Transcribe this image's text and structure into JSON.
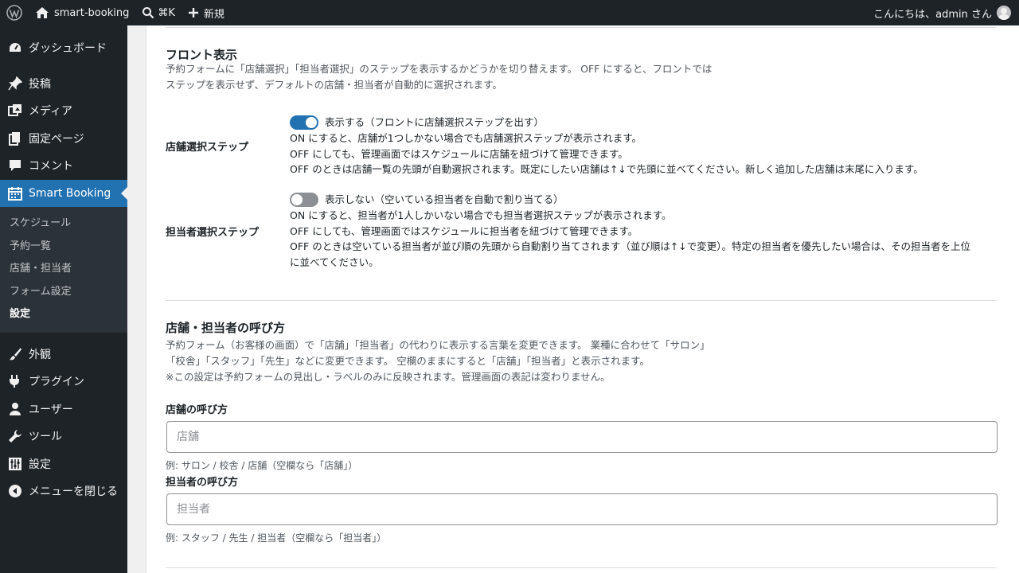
{
  "adminbar": {
    "site_name": "smart-booking",
    "search_shortcut": "⌘K",
    "new_label": "新規",
    "greeting": "こんにちは、admin さん"
  },
  "menu": {
    "dashboard": "ダッシュボード",
    "posts": "投稿",
    "media": "メディア",
    "pages": "固定ページ",
    "comments": "コメント",
    "smart_booking": "Smart Booking",
    "submenu": [
      "スケジュール",
      "予約一覧",
      "店舗・担当者",
      "フォーム設定",
      "設定"
    ],
    "appearance": "外観",
    "plugins": "プラグイン",
    "users": "ユーザー",
    "tools": "ツール",
    "settings": "設定",
    "collapse": "メニューを閉じる"
  },
  "front_display": {
    "title": "フロント表示",
    "description_line1": "予約フォームに「店舗選択」「担当者選択」のステップを表示するかどうかを切り替えます。 OFF にすると、フロントでは",
    "description_line2": "ステップを表示せず、デフォルトの店舗・担当者が自動的に選択されます。",
    "store_step": {
      "label": "店舗選択ステップ",
      "toggle_state": "on",
      "toggle_text": "表示する（フロントに店舗選択ステップを出す）",
      "note1": "ON にすると、店舗が1つしかない場合でも店舗選択ステップが表示されます。",
      "note2": "OFF にしても、管理画面ではスケジュールに店舗を紐づけて管理できます。",
      "note3": "OFF のときは店舗一覧の先頭が自動選択されます。既定にしたい店舗は↑↓で先頭に並べてください。新しく追加した店舗は末尾に入ります。"
    },
    "staff_step": {
      "label": "担当者選択ステップ",
      "toggle_state": "off",
      "toggle_text": "表示しない（空いている担当者を自動で割り当てる）",
      "note1": "ON にすると、担当者が1人しかいない場合でも担当者選択ステップが表示されます。",
      "note2": "OFF にしても、管理画面ではスケジュールに担当者を紐づけて管理できます。",
      "note3a": "OFF のときは空いている担当者が並び順の先頭から自動割り当てされます（並び順は↑↓で変更）。特定の担当者を優先したい場合は、その担当者を上位",
      "note3b": "に並べてください。"
    }
  },
  "naming": {
    "title": "店舗・担当者の呼び方",
    "description_line1": "予約フォーム（お客様の画面）で「店舗」「担当者」の代わりに表示する言葉を変更できます。 業種に合わせて「サロン」",
    "description_line2": "「校舎」「スタッフ」「先生」などに変更できます。 空欄のままにすると「店舗」「担当者」と表示されます。",
    "description_line3": "※この設定は予約フォームの見出し・ラベルのみに反映されます。管理画面の表記は変わりません。",
    "store_field": {
      "label": "店舗の呼び方",
      "value": "",
      "placeholder": "店舗",
      "hint": "例: サロン / 校舎 / 店舗（空欄なら「店舗」）"
    },
    "staff_field": {
      "label": "担当者の呼び方",
      "value": "",
      "placeholder": "担当者",
      "hint": "例: スタッフ / 先生 / 担当者（空欄なら「担当者」）"
    }
  }
}
